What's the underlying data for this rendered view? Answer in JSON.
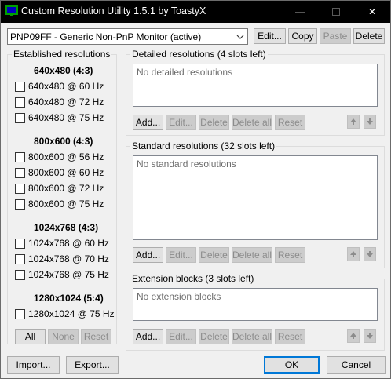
{
  "window": {
    "title": "Custom Resolution Utility 1.5.1 by ToastyX",
    "minimize_glyph": "—",
    "close_glyph": "✕"
  },
  "monitor": {
    "selected": "PNP09FF - Generic Non-PnP Monitor (active)",
    "buttons": {
      "edit": "Edit...",
      "copy": "Copy",
      "paste": "Paste",
      "delete": "Delete"
    }
  },
  "established": {
    "title": "Established resolutions",
    "sections": [
      {
        "header": "640x480 (4:3)",
        "items": [
          "640x480 @ 60 Hz",
          "640x480 @ 72 Hz",
          "640x480 @ 75 Hz"
        ]
      },
      {
        "header": "800x600 (4:3)",
        "items": [
          "800x600 @ 56 Hz",
          "800x600 @ 60 Hz",
          "800x600 @ 72 Hz",
          "800x600 @ 75 Hz"
        ]
      },
      {
        "header": "1024x768 (4:3)",
        "items": [
          "1024x768 @ 60 Hz",
          "1024x768 @ 70 Hz",
          "1024x768 @ 75 Hz"
        ]
      },
      {
        "header": "1280x1024 (5:4)",
        "items": [
          "1280x1024 @ 75 Hz"
        ]
      }
    ],
    "buttons": {
      "all": "All",
      "none": "None",
      "reset": "Reset"
    }
  },
  "detailed": {
    "title": "Detailed resolutions (4 slots left)",
    "empty_text": "No detailed resolutions",
    "buttons": {
      "add": "Add...",
      "edit": "Edit...",
      "delete": "Delete",
      "delete_all": "Delete all",
      "reset": "Reset"
    }
  },
  "standard": {
    "title": "Standard resolutions (32 slots left)",
    "empty_text": "No standard resolutions",
    "buttons": {
      "add": "Add...",
      "edit": "Edit...",
      "delete": "Delete",
      "delete_all": "Delete all",
      "reset": "Reset"
    }
  },
  "extension": {
    "title": "Extension blocks (3 slots left)",
    "empty_text": "No extension blocks",
    "buttons": {
      "add": "Add...",
      "edit": "Edit...",
      "delete": "Delete",
      "delete_all": "Delete all",
      "reset": "Reset"
    }
  },
  "footer": {
    "import": "Import...",
    "export": "Export...",
    "ok": "OK",
    "cancel": "Cancel"
  },
  "colors": {
    "titlebar": "#000000",
    "accent": "#0078d7",
    "face": "#f0f0f0"
  }
}
